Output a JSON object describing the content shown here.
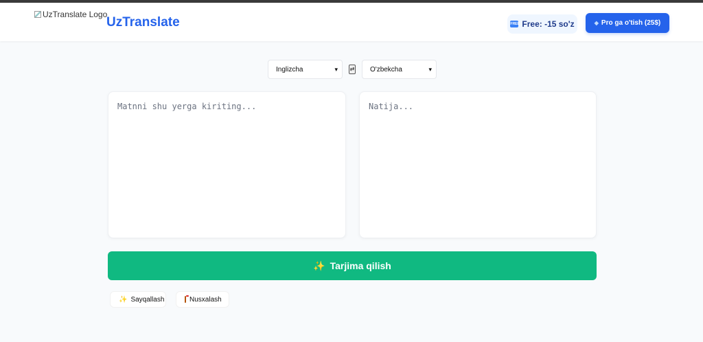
{
  "header": {
    "logo_alt": "UzTranslate Logo",
    "brand": "UzTranslate",
    "free_badge_icon": "free-icon",
    "free_badge_icon_text": "FREE",
    "free_badge": "Free: -15 so'z",
    "pro_icon": "diamond-icon",
    "pro_button": "Pro ga o'tish (25$)"
  },
  "languages": {
    "source": "Inglizcha",
    "target": "O'zbekcha",
    "swap_glyph": "⇄"
  },
  "editor": {
    "source_placeholder": "Matnni shu yerga kiriting...",
    "target_placeholder": "Natija..."
  },
  "actions": {
    "translate_icon": "sparkles-icon",
    "translate": "Tarjima qilish",
    "polish": "Sayqallash",
    "copy_icon": "clipboard-icon",
    "copy": "Nusxalash"
  },
  "colors": {
    "brand": "#2563eb",
    "translate_button": "#10b981",
    "pro_button": "#2563eb"
  }
}
